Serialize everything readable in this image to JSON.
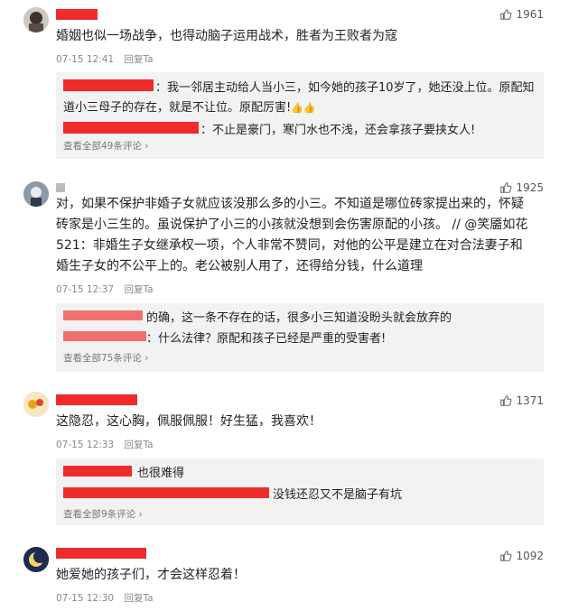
{
  "comments": [
    {
      "likes": "1961",
      "text": "婚姻也似一场战争，也得动脑子运用战术，胜者为王败者为寇",
      "time": "07-15 12:41",
      "reply_label": "回复Ta",
      "replies": [
        {
          "text": "：我一邻居主动给人当小三，如今她的孩子10岁了，她还没上位。原配知"
        },
        {
          "text": "道小三母子的存在，就是不让位。原配厉害!"
        },
        {
          "text": "：不止是豪门，寒门水也不浅，还会拿孩子要挟女人!"
        }
      ],
      "more": "查看全部49条评论 ›"
    },
    {
      "likes": "1925",
      "lines": [
        "对，如果不保护非婚子女就应该没那么多的小三。不知道是哪位砖家提出来的，怀疑",
        "砖家是小三生的。虽说保护了小三的小孩就没想到会伤害原配的小孩。 // @笑靥如花",
        "521：非婚生子女继承权一项，个人非常不赞同，对他的公平是建立在对合法妻子和",
        "婚生子女的不公平上的。老公被别人用了，还得给分钱，什么道理"
      ],
      "time": "07-15 12:37",
      "reply_label": "回复Ta",
      "replies": [
        {
          "text": "的确，这一条不存在的话，很多小三知道没盼头就会放弃的"
        },
        {
          "text": "：什么法律？原配和孩子已经是严重的受害者!"
        }
      ],
      "more": "查看全部75条评论 ›"
    },
    {
      "likes": "1371",
      "text": "这隐忍，这心胸，佩服佩服！好生猛，我喜欢！",
      "time": "07-15 12:33",
      "reply_label": "回复Ta",
      "replies": [
        {
          "text": "也很难得"
        },
        {
          "text": "没钱还忍又不是脑子有坑"
        }
      ],
      "more": "查看全部9条评论 ›"
    },
    {
      "likes": "1092",
      "text": "她爱她的孩子们，才会这样忍着！",
      "time": "07-15 12:30",
      "reply_label": "回复Ta"
    }
  ]
}
